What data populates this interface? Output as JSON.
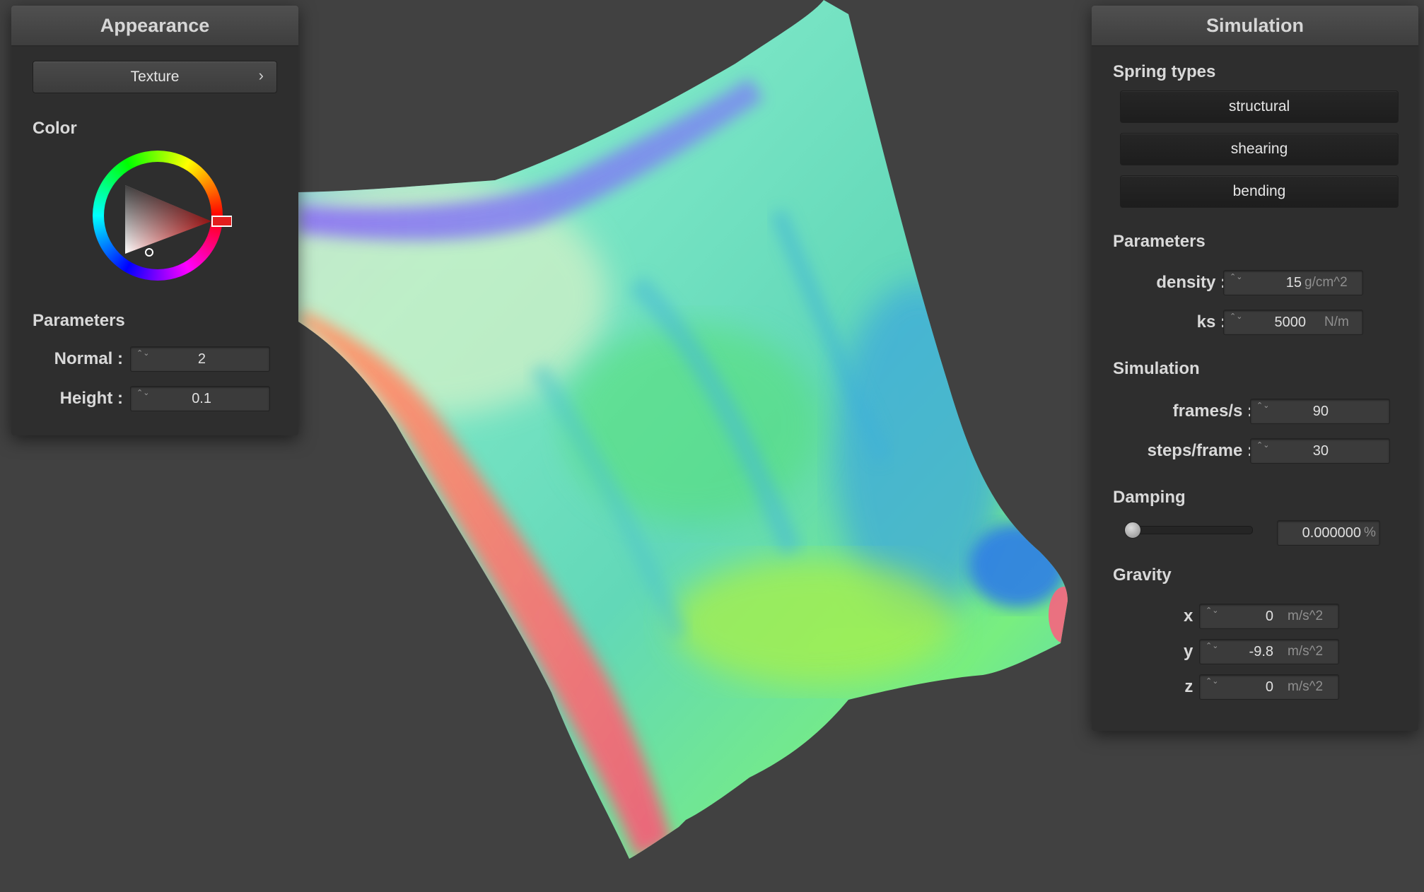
{
  "appearance": {
    "title": "Appearance",
    "texture_button": "Texture",
    "texture_chevron": "›",
    "color_label": "Color",
    "parameters_label": "Parameters",
    "normal_label": "Normal :",
    "normal_value": "2",
    "height_label": "Height :",
    "height_value": "0.1",
    "selected_color": "#e31e1e"
  },
  "simulation": {
    "title": "Simulation",
    "spring_types_label": "Spring types",
    "spring_buttons": [
      "structural",
      "shearing",
      "bending"
    ],
    "parameters_label": "Parameters",
    "density_label": "density :",
    "density_value": "15",
    "density_unit": "g/cm^2",
    "ks_label": "ks :",
    "ks_value": "5000",
    "ks_unit": "N/m",
    "simulation_label": "Simulation",
    "fps_label": "frames/s :",
    "fps_value": "90",
    "steps_label": "steps/frame :",
    "steps_value": "30",
    "damping_label": "Damping",
    "damping_level": 0,
    "damping_value": "0.000000",
    "damping_unit": "%",
    "gravity_label": "Gravity",
    "gx_label": "x :",
    "gx_value": "0",
    "gy_label": "y :",
    "gy_value": "-9.8",
    "gz_label": "z :",
    "gz_value": "0",
    "gravity_unit": "m/s^2"
  },
  "spin_icon": "⌃⌄"
}
